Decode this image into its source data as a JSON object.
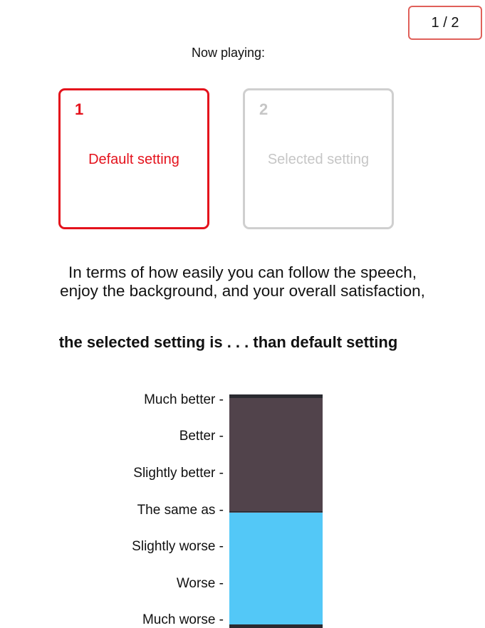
{
  "counter": {
    "text": "1 / 2"
  },
  "now_playing": {
    "label": "Now playing:"
  },
  "settings": [
    {
      "number": "1",
      "label": "Default setting",
      "state": "active",
      "color": "#e4121c"
    },
    {
      "number": "2",
      "label": "Selected setting",
      "state": "inactive",
      "color": "#c6c6c6"
    }
  ],
  "question": {
    "line1": "In terms of how easily you can follow the speech,",
    "line2": "enjoy the background, and your overall satisfaction,"
  },
  "statement": "the selected setting is . . . than default setting",
  "rating_scale": {
    "labels": [
      "Much better -",
      "Better -",
      "Slightly better -",
      "The same as -",
      "Slightly worse -",
      "Worse -",
      "Much worse -"
    ],
    "current_value": "The same as",
    "current_fraction": 0.5,
    "colors": {
      "upper": "#51434b",
      "lower": "#53c8f7"
    }
  }
}
